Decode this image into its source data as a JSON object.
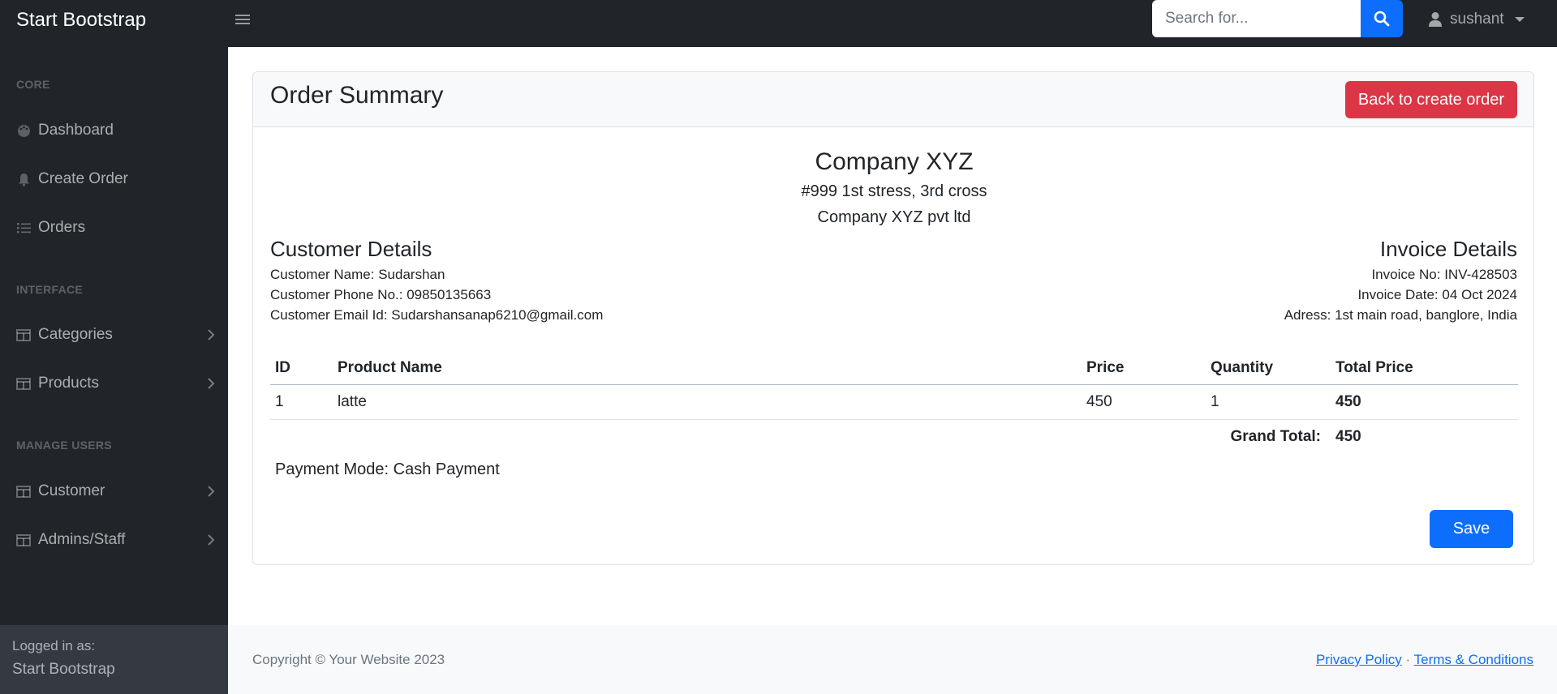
{
  "navbar": {
    "brand": "Start Bootstrap",
    "search_placeholder": "Search for...",
    "user": "sushant"
  },
  "sidebar": {
    "sections": [
      {
        "heading": "CORE",
        "items": [
          {
            "label": "Dashboard",
            "icon": "palette-icon"
          },
          {
            "label": "Create Order",
            "icon": "bell-icon"
          },
          {
            "label": "Orders",
            "icon": "list-icon"
          }
        ]
      },
      {
        "heading": "INTERFACE",
        "items": [
          {
            "label": "Categories",
            "icon": "columns-icon"
          },
          {
            "label": "Products",
            "icon": "columns-icon"
          }
        ]
      },
      {
        "heading": "MANAGE USERS",
        "items": [
          {
            "label": "Customer",
            "icon": "columns-icon"
          },
          {
            "label": "Admins/Staff",
            "icon": "columns-icon"
          }
        ]
      }
    ],
    "footer": {
      "label": "Logged in as:",
      "name": "Start Bootstrap"
    }
  },
  "card": {
    "title": "Order Summary",
    "back_button": "Back to create order",
    "company": {
      "name": "Company XYZ",
      "address": "#999 1st stress, 3rd cross",
      "legal_name": "Company XYZ pvt ltd"
    },
    "customer": {
      "heading": "Customer Details",
      "name": "Customer Name: Sudarshan",
      "phone": "Customer Phone No.: 09850135663",
      "email": "Customer Email Id: Sudarshansanap6210@gmail.com"
    },
    "invoice": {
      "heading": "Invoice Details",
      "number": "Invoice No: INV-428503",
      "date": "Invoice Date: 04 Oct 2024",
      "address": "Adress: 1st main road, banglore, India"
    },
    "table": {
      "headers": [
        "ID",
        "Product Name",
        "Price",
        "Quantity",
        "Total Price"
      ],
      "rows": [
        {
          "id": "1",
          "product": "latte",
          "price": "450",
          "quantity": "1",
          "total": "450"
        }
      ],
      "grand_total_label": "Grand Total:",
      "grand_total_value": "450"
    },
    "payment_mode": "Payment Mode: Cash Payment",
    "save_button": "Save"
  },
  "footer": {
    "copyright": "Copyright © Your Website 2023",
    "privacy": "Privacy Policy",
    "separator": "·",
    "terms": "Terms & Conditions"
  },
  "colors": {
    "navbar_bg": "#212529",
    "primary": "#0d6efd",
    "danger": "#dc3545"
  }
}
